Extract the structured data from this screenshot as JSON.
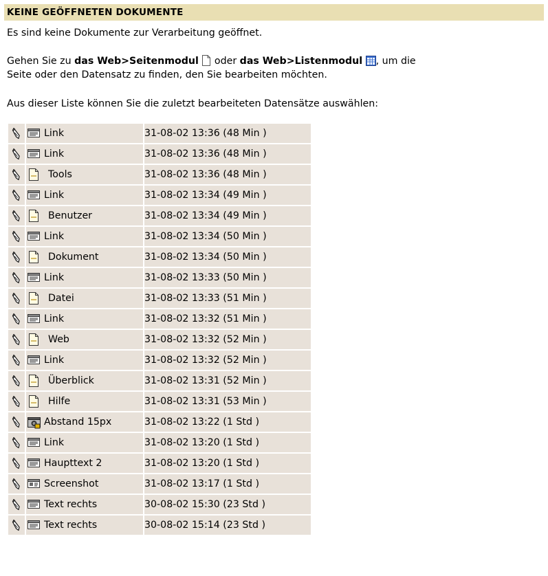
{
  "header": {
    "title": "KEINE GEÖFFNETEN DOKUMENTE"
  },
  "intro": "Es sind keine Dokumente zur Verarbeitung geöffnet.",
  "nav": {
    "text1": "Gehen Sie zu ",
    "link1": "das Web>Seitenmodul",
    "text2": " oder ",
    "link2": "das Web>Listenmodul",
    "text3": ", um die",
    "line2": "Seite oder den Datensatz zu finden, den Sie bearbeiten möchten."
  },
  "list_intro": "Aus dieser Liste können Sie die zuletzt bearbeiteten Datensätze auswählen:",
  "records": [
    {
      "icon": "content-element-icon",
      "label": "Link",
      "time": "31-08-02 13:36 (48 Min )"
    },
    {
      "icon": "content-element-icon",
      "label": "Link",
      "time": "31-08-02 13:36 (48 Min )"
    },
    {
      "icon": "page-icon",
      "label": "Tools",
      "time": "31-08-02 13:36 (48 Min )"
    },
    {
      "icon": "content-element-icon",
      "label": "Link",
      "time": "31-08-02 13:34 (49 Min )"
    },
    {
      "icon": "page-icon",
      "label": "Benutzer",
      "time": "31-08-02 13:34 (49 Min )"
    },
    {
      "icon": "content-element-icon",
      "label": "Link",
      "time": "31-08-02 13:34 (50 Min )"
    },
    {
      "icon": "page-icon",
      "label": "Dokument",
      "time": "31-08-02 13:34 (50 Min )"
    },
    {
      "icon": "content-element-icon",
      "label": "Link",
      "time": "31-08-02 13:33 (50 Min )"
    },
    {
      "icon": "page-icon",
      "label": "Datei",
      "time": "31-08-02 13:33 (51 Min )"
    },
    {
      "icon": "content-element-icon",
      "label": "Link",
      "time": "31-08-02 13:32 (51 Min )"
    },
    {
      "icon": "page-icon",
      "label": "Web",
      "time": "31-08-02 13:32 (52 Min )"
    },
    {
      "icon": "content-element-icon",
      "label": "Link",
      "time": "31-08-02 13:32 (52 Min )"
    },
    {
      "icon": "page-icon",
      "label": "Überblick",
      "time": "31-08-02 13:31 (52 Min )"
    },
    {
      "icon": "page-icon",
      "label": "Hilfe",
      "time": "31-08-02 13:31 (53 Min )"
    },
    {
      "icon": "spacer-image-icon",
      "label": "Abstand 15px",
      "time": "31-08-02 13:22 (1 Std )"
    },
    {
      "icon": "content-element-icon",
      "label": "Link",
      "time": "31-08-02 13:20 (1 Std )"
    },
    {
      "icon": "content-element-icon",
      "label": "Haupttext 2",
      "time": "31-08-02 13:20 (1 Std )"
    },
    {
      "icon": "image-content-icon",
      "label": "Screenshot",
      "time": "31-08-02 13:17 (1 Std )"
    },
    {
      "icon": "content-element-icon",
      "label": "Text rechts",
      "time": "30-08-02 15:30 (23 Std )"
    },
    {
      "icon": "content-element-icon",
      "label": "Text rechts",
      "time": "30-08-02 15:14 (23 Std )"
    }
  ],
  "colors": {
    "header_bg": "#e9dfb3",
    "row_bg": "#e8e1d9"
  }
}
